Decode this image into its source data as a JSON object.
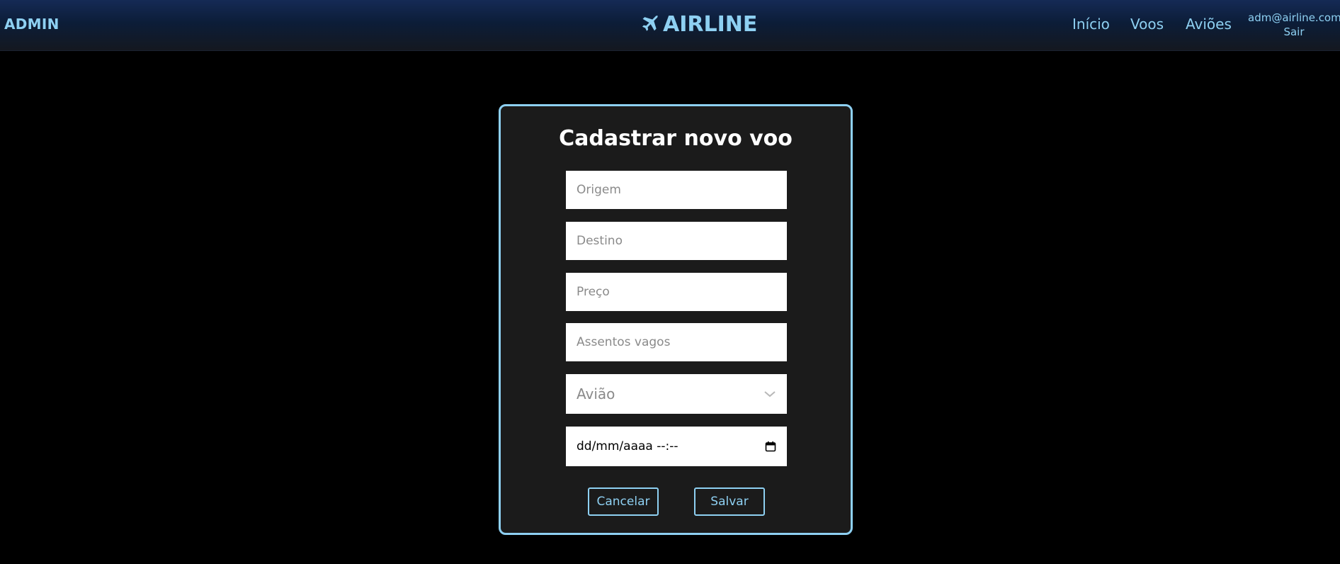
{
  "header": {
    "brand": "ADMIN",
    "logo_text": "AIRLINE",
    "logo_icon": "airplane-icon",
    "nav": {
      "inicio": "Início",
      "voos": "Voos",
      "avioes": "Aviões"
    },
    "user": {
      "email": "adm@airline.com",
      "logout": "Sair"
    }
  },
  "form": {
    "title": "Cadastrar novo voo",
    "origem_placeholder": "Origem",
    "destino_placeholder": "Destino",
    "preco_placeholder": "Preço",
    "assentos_placeholder": "Assentos vagos",
    "aviao_select": "Avião",
    "datetime_value": "dd/mm/aaaa --:--",
    "cancel_label": "Cancelar",
    "save_label": "Salvar"
  },
  "colors": {
    "accent": "#8ed0f2",
    "card_background": "#1b1b1b",
    "page_background": "#000000"
  }
}
